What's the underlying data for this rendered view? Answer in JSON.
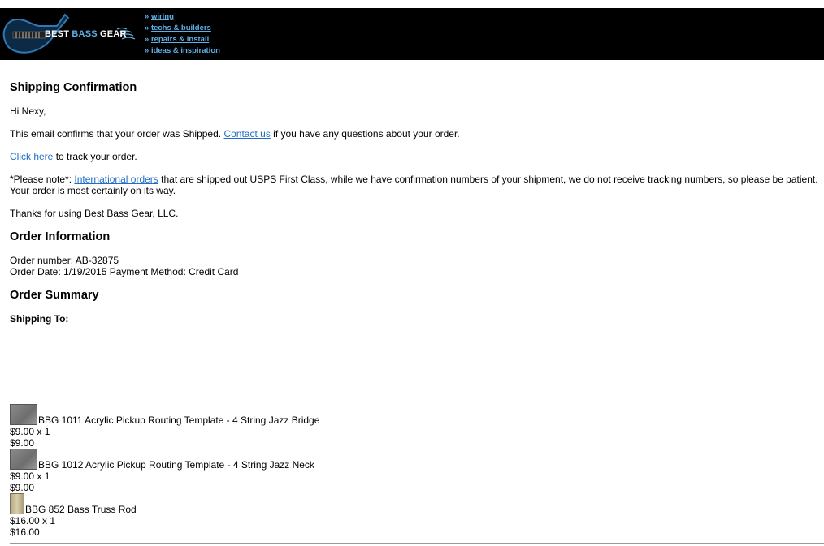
{
  "header": {
    "logo_best": "BEST ",
    "logo_bass": "BASS",
    "logo_gear": " GEAR",
    "nav": [
      {
        "raquo": "»",
        "label": "wiring"
      },
      {
        "raquo": "»",
        "label": "techs & builders"
      },
      {
        "raquo": "»",
        "label": "repairs & install"
      },
      {
        "raquo": "»",
        "label": "ideas & inspiration"
      }
    ]
  },
  "email": {
    "title": "Shipping Confirmation",
    "greeting": "Hi Nexy,",
    "confirm_before": "This email confirms that your order was Shipped. ",
    "contact_link": "Contact us",
    "confirm_after": " if you have any questions about your order.",
    "track_link": "Click here",
    "track_after": " to track your order.",
    "note_before": "*Please note*: ",
    "note_link": "International orders",
    "note_after": " that are shipped out USPS First Class, while we have confirmation numbers of your shipment, we do not receive tracking numbers, so please be patient. Your order is most certainly on its way.",
    "thanks": "Thanks for using Best Bass Gear, LLC."
  },
  "order_info": {
    "heading": "Order Information",
    "order_number": "Order number: AB-32875",
    "order_date": "Order Date: 1/19/2015 Payment Method: Credit Card"
  },
  "order_summary": {
    "heading": "Order Summary",
    "shipping_to": "Shipping To:",
    "items": [
      {
        "name": "BBG 1011 Acrylic Pickup Routing Template - 4 String Jazz Bridge",
        "price_qty": "$9.00 x 1",
        "total": "$9.00"
      },
      {
        "name": "BBG 1012 Acrylic Pickup Routing Template - 4 String Jazz Neck",
        "price_qty": "$9.00 x 1",
        "total": "$9.00"
      },
      {
        "name": "BBG 852 Bass Truss Rod",
        "price_qty": "$16.00 x 1",
        "total": "$16.00"
      }
    ]
  },
  "colors": {
    "link": "#1f6dc6",
    "nav_link": "#5fb0e6",
    "banner": "#000000"
  }
}
